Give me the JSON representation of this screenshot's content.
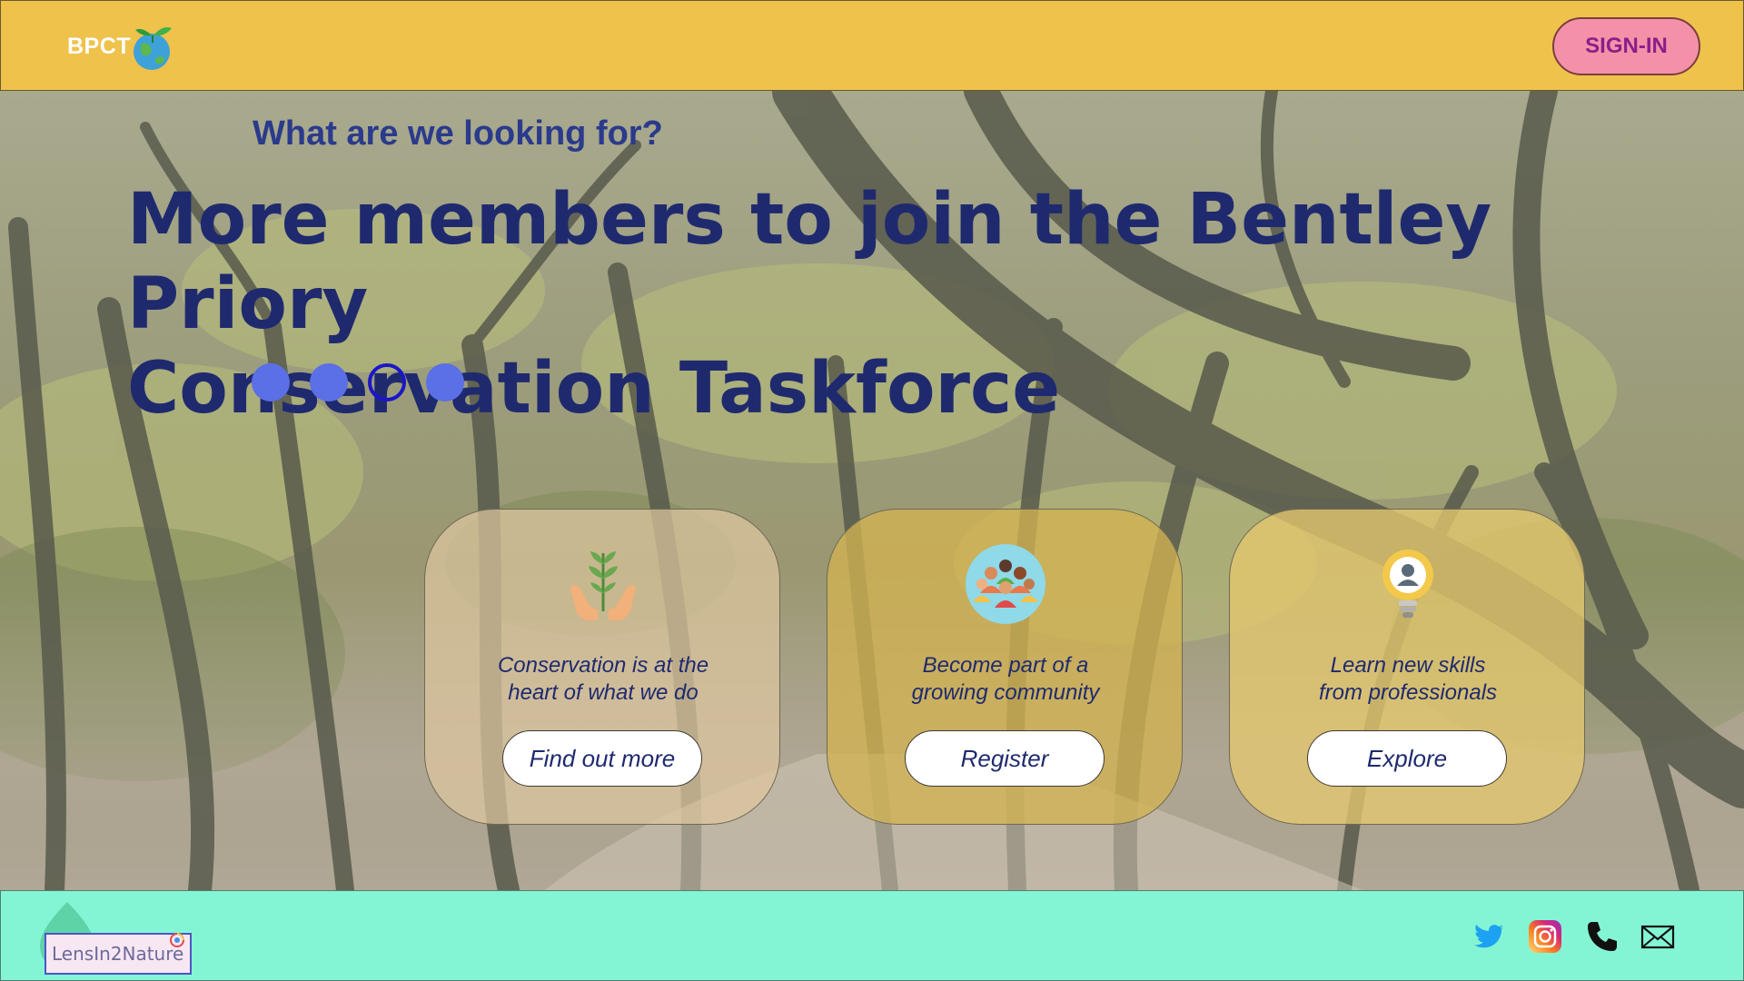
{
  "header": {
    "logo_text": "BPCT",
    "signin_label": "SIGN-IN"
  },
  "hero": {
    "kicker": "What are we looking for?",
    "headline_line1": "More members to join the Bentley Priory",
    "headline_line2": "Conservation Taskforce",
    "carousel": {
      "total": 4,
      "active_index": 2
    }
  },
  "cards": [
    {
      "line1": "Conservation is at the",
      "line2": "heart of what we do",
      "button": "Find out more",
      "icon": "hands-sprout-icon"
    },
    {
      "line1": "Become part of a",
      "line2": "growing community",
      "button": "Register",
      "icon": "community-people-icon"
    },
    {
      "line1": "Learn new skills",
      "line2": "from professionals",
      "button": "Explore",
      "icon": "lightbulb-person-icon"
    }
  ],
  "footer": {
    "brand": "LensIn2Nature",
    "social": [
      "twitter-icon",
      "instagram-icon",
      "phone-icon",
      "mail-icon"
    ]
  },
  "colors": {
    "header_bg": "#efc24c",
    "signin_bg": "#f491a8",
    "signin_text": "#8a1e8a",
    "headline": "#1f2a6e",
    "dot": "#5b6fe6",
    "footer_bg": "#84f5d4"
  }
}
